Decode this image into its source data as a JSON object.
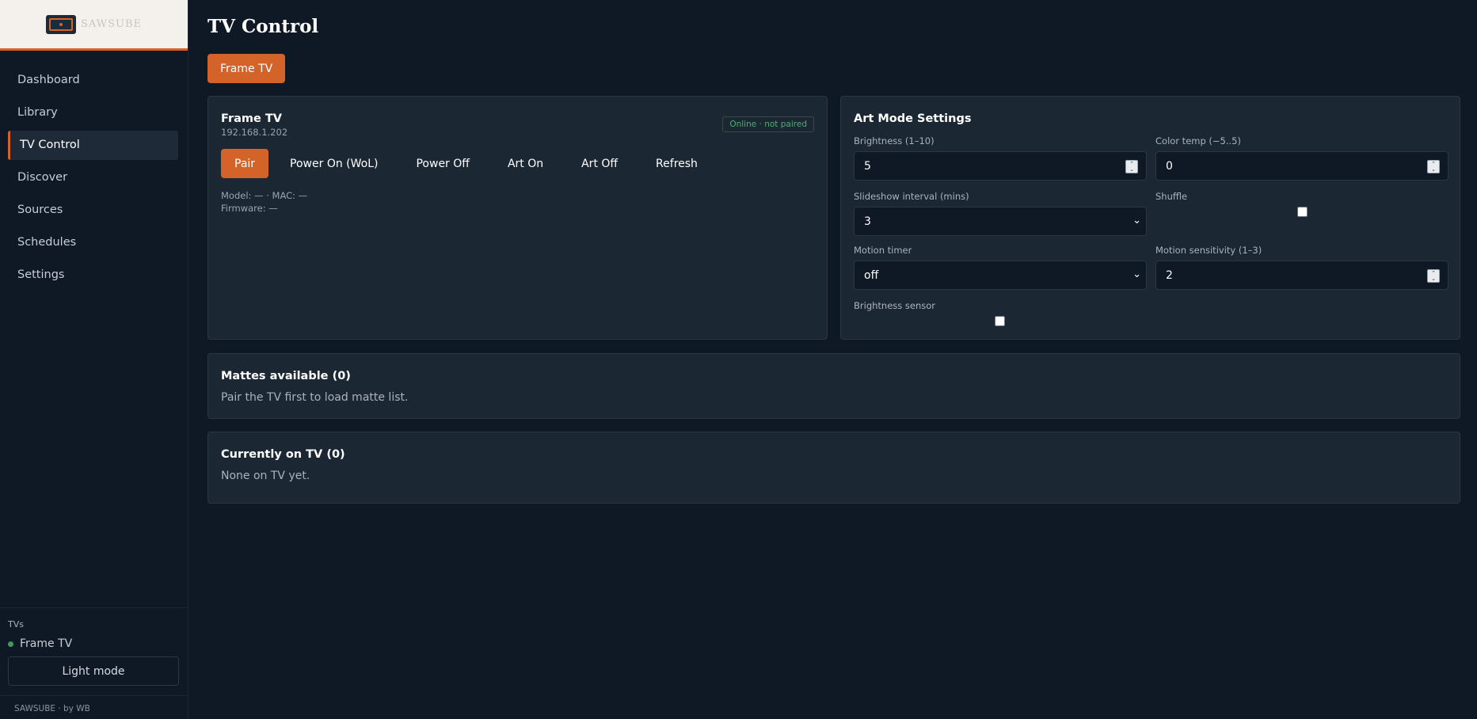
{
  "brand": {
    "name": "SAWSUBE",
    "accent": "#d4632a"
  },
  "nav": {
    "items": [
      {
        "label": "Dashboard"
      },
      {
        "label": "Library"
      },
      {
        "label": "TV Control"
      },
      {
        "label": "Discover"
      },
      {
        "label": "Sources"
      },
      {
        "label": "Schedules"
      },
      {
        "label": "Settings"
      }
    ]
  },
  "sidebar_bottom": {
    "tvs_label": "TVs",
    "tv_name": "Frame TV",
    "light_mode_label": "Light mode",
    "footer": "SAWSUBE · by WB"
  },
  "page": {
    "title": "TV Control",
    "tv_tab": "Frame TV"
  },
  "device": {
    "name": "Frame TV",
    "ip": "192.168.1.202",
    "status": "Online · not paired",
    "actions": [
      "Pair",
      "Power On (WoL)",
      "Power Off",
      "Art On",
      "Art Off",
      "Refresh"
    ],
    "model_line": "Model: — · MAC: —",
    "firmware_line": "Firmware: —"
  },
  "art_mode": {
    "title": "Art Mode Settings",
    "brightness_label": "Brightness (1–10)",
    "brightness_value": "5",
    "color_temp_label": "Color temp (−5..5)",
    "color_temp_value": "0",
    "slideshow_label": "Slideshow interval (mins)",
    "slideshow_value": "3",
    "shuffle_label": "Shuffle",
    "motion_timer_label": "Motion timer",
    "motion_timer_value": "off",
    "motion_sensitivity_label": "Motion sensitivity (1–3)",
    "motion_sensitivity_value": "2",
    "brightness_sensor_label": "Brightness sensor"
  },
  "mattes": {
    "title": "Mattes available (0)",
    "text": "Pair the TV first to load matte list."
  },
  "current": {
    "title": "Currently on TV (0)",
    "text": "None on TV yet."
  },
  "icons": {
    "logo": "tv-frame-icon",
    "status_dot": "online-dot-icon",
    "spinner": "number-stepper-icon",
    "dropdown": "chevron-down-icon"
  }
}
